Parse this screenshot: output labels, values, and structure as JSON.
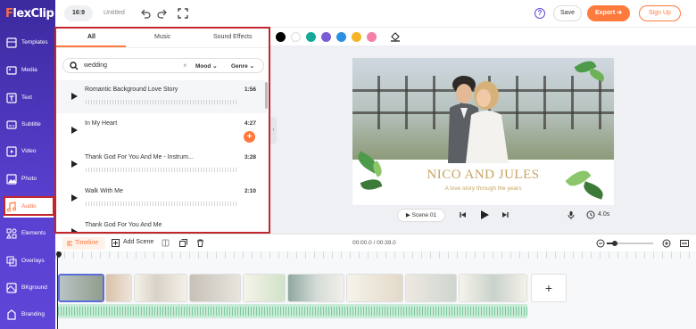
{
  "app": {
    "logo_prefix": "F",
    "logo_rest": "lexClip"
  },
  "sidebar": {
    "items": [
      {
        "label": "Templates",
        "icon": "templates-icon"
      },
      {
        "label": "Media",
        "icon": "media-icon"
      },
      {
        "label": "Text",
        "icon": "text-icon"
      },
      {
        "label": "Subtitle",
        "icon": "subtitle-icon"
      },
      {
        "label": "Video",
        "icon": "video-icon"
      },
      {
        "label": "Photo",
        "icon": "photo-icon"
      },
      {
        "label": "Audio",
        "icon": "music-note-icon",
        "active": true
      },
      {
        "label": "Elements",
        "icon": "elements-icon"
      },
      {
        "label": "Overlays",
        "icon": "overlays-icon"
      },
      {
        "label": "BKground",
        "icon": "background-icon"
      },
      {
        "label": "Branding",
        "icon": "branding-icon"
      }
    ]
  },
  "topbar": {
    "ratio": "16:9",
    "project_name": "Untitled",
    "save_label": "Save",
    "export_label": "Export",
    "signup_label": "Sign Up",
    "help_label": "?"
  },
  "audio_panel": {
    "tabs": [
      "All",
      "Music",
      "Sound Effects"
    ],
    "active_tab": "All",
    "search": {
      "value": "wedding",
      "clear": "×",
      "mood_label": "Mood",
      "genre_label": "Genre"
    },
    "tracks": [
      {
        "title": "Romantic Background Love Story",
        "duration": "1:56"
      },
      {
        "title": "In My Heart",
        "duration": "4:27"
      },
      {
        "title": "Thank God For You And Me - Instrum...",
        "duration": "3:28"
      },
      {
        "title": "Walk With Me",
        "duration": "2:10"
      },
      {
        "title": "Thank God For You And Me",
        "duration": ""
      }
    ]
  },
  "colorbar": {
    "swatches": [
      "#000000",
      "#ffffff",
      "#16a89a",
      "#7b5cd6",
      "#2a8fe0",
      "#f5b325",
      "#f37ea7"
    ]
  },
  "preview": {
    "title": "NICO AND JULES",
    "subtitle": "A love story through the years",
    "scene_label": "Scene",
    "scene_number": "01",
    "duration": "4.0s"
  },
  "timeline": {
    "timeline_label": "Timeline",
    "add_scene_label": "Add Scene",
    "time": "00:00.0 / 00:39.0",
    "add_clip": "+",
    "zoom_level": 0.18
  },
  "colors": {
    "accent": "#ff7a3d",
    "sidebar": "#4a34b8",
    "highlight": "#c0262c",
    "gold": "#c6a463"
  }
}
